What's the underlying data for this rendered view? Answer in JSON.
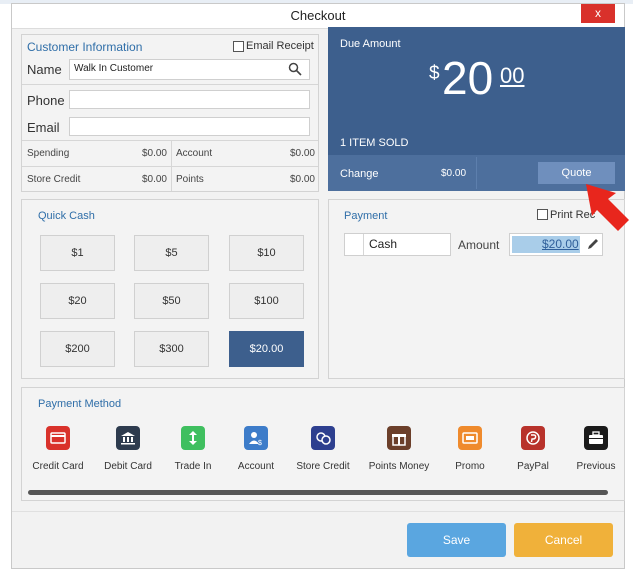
{
  "dialog": {
    "title": "Checkout",
    "close_label": "x"
  },
  "customer": {
    "section_title": "Customer Information",
    "email_receipt_label": "Email Receipt",
    "name_label": "Name",
    "name_value": "Walk In Customer",
    "phone_label": "Phone",
    "email_label": "Email",
    "stats": [
      {
        "label": "Spending",
        "value": "$0.00"
      },
      {
        "label": "Account",
        "value": "$0.00"
      },
      {
        "label": "Store Credit",
        "value": "$0.00"
      },
      {
        "label": "Points",
        "value": "$0.00"
      }
    ]
  },
  "due": {
    "label": "Due Amount",
    "currency": "$",
    "whole": "20",
    "cents": "00",
    "items_sold": "1 ITEM SOLD",
    "change_label": "Change",
    "change_value": "$0.00",
    "quote_label": "Quote"
  },
  "quick_cash": {
    "title": "Quick Cash",
    "buttons": [
      "$1",
      "$5",
      "$10",
      "$20",
      "$50",
      "$100",
      "$200",
      "$300",
      "$20.00"
    ]
  },
  "payment": {
    "title": "Payment",
    "print_label": "Print Rec",
    "method_value": "Cash",
    "amount_label": "Amount",
    "amount_value": "$20.00"
  },
  "payment_methods": {
    "title": "Payment Method",
    "items": [
      {
        "label": "Credit Card",
        "icon": "credit-card-icon",
        "color": "#d9322b"
      },
      {
        "label": "Debit Card",
        "icon": "bank-icon",
        "color": "#2d3b4e"
      },
      {
        "label": "Trade In",
        "icon": "trade-in-icon",
        "color": "#3fbf5f"
      },
      {
        "label": "Account",
        "icon": "account-icon",
        "color": "#3d7cc9"
      },
      {
        "label": "Store Credit",
        "icon": "store-credit-icon",
        "color": "#2d3f8f"
      },
      {
        "label": "Points Money",
        "icon": "gift-icon",
        "color": "#6b3f2a"
      },
      {
        "label": "Promo",
        "icon": "promo-icon",
        "color": "#ef8a2c"
      },
      {
        "label": "PayPal",
        "icon": "paypal-icon",
        "color": "#b8322b"
      },
      {
        "label": "Previous",
        "icon": "briefcase-icon",
        "color": "#1a1a1a"
      }
    ]
  },
  "footer": {
    "save_label": "Save",
    "cancel_label": "Cancel"
  },
  "colors": {
    "accent": "#3d5f8d",
    "save": "#5aa6e0",
    "cancel": "#f0b13a",
    "arrow": "#e8261d"
  }
}
